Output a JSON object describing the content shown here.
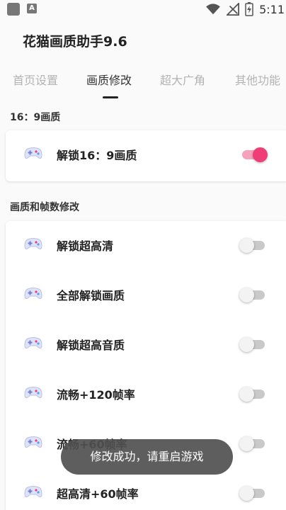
{
  "status_bar": {
    "time": "5:11",
    "app_icon_2_letter": "A",
    "icons": [
      "app-icon",
      "app-icon",
      "wifi-icon",
      "signal-off-icon",
      "battery-charging-icon"
    ]
  },
  "header": {
    "title": "花猫画质助手9.6"
  },
  "tabs": [
    {
      "label": "首页设置",
      "active": false
    },
    {
      "label": "画质修改",
      "active": true
    },
    {
      "label": "超大广角",
      "active": false
    },
    {
      "label": "其他功能",
      "active": false
    }
  ],
  "sections": [
    {
      "label": "16：9画质",
      "items": [
        {
          "label": "解锁16：9画质",
          "on": true
        }
      ]
    },
    {
      "label": "画质和帧数修改",
      "items": [
        {
          "label": "解锁超高清",
          "on": false
        },
        {
          "label": "全部解锁画质",
          "on": false
        },
        {
          "label": "解锁超高音质",
          "on": false
        },
        {
          "label": "流畅+120帧率",
          "on": false
        },
        {
          "label": "流畅+60帧率",
          "on": false
        },
        {
          "label": "超高清+60帧率",
          "on": false
        }
      ]
    }
  ],
  "toast": {
    "message": "修改成功，请重启游戏"
  },
  "colors": {
    "accent": "#ef3e77",
    "accent_track": "#f5a3bd",
    "off_track": "#c9c9c9"
  }
}
